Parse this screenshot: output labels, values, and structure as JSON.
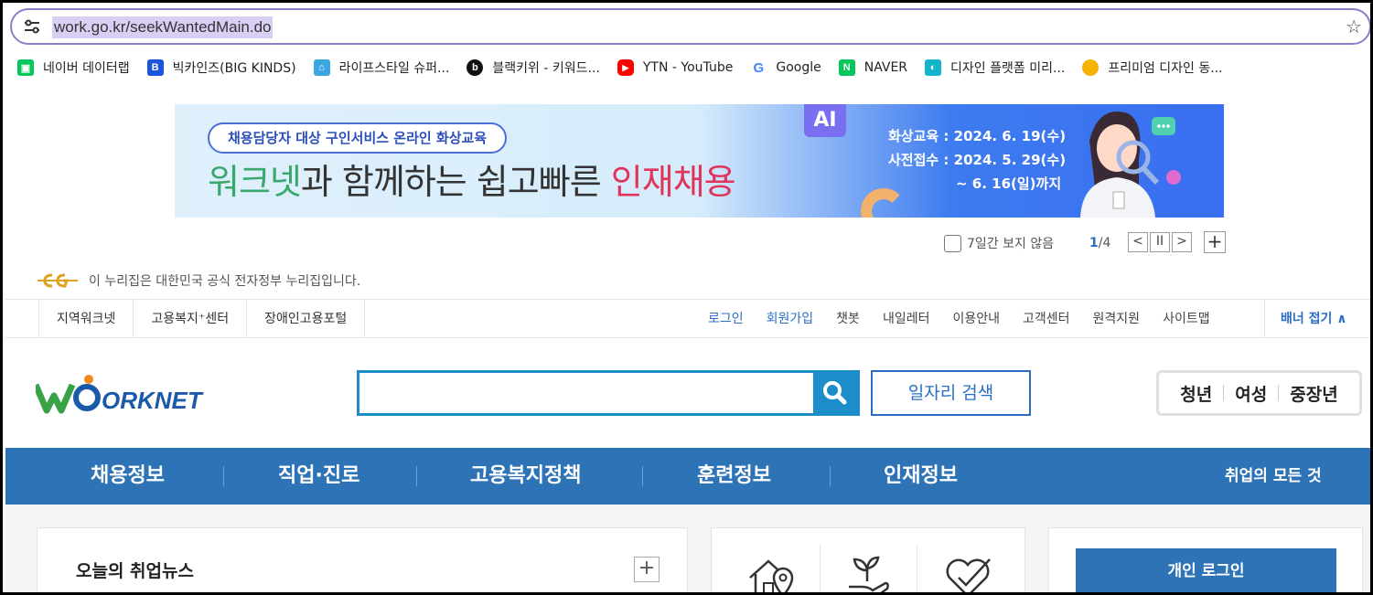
{
  "browser": {
    "url": "work.go.kr/seekWantedMain.do",
    "bookmarks": [
      {
        "label": "네이버 데이터랩",
        "icon": "naver-datalab-icon",
        "color": "#03c75a",
        "glyph": "▣"
      },
      {
        "label": "빅카인즈(BIG KINDS)",
        "icon": "bigkinds-icon",
        "color": "#1a56db",
        "glyph": "B"
      },
      {
        "label": "라이프스타일 슈퍼...",
        "icon": "lifestyle-icon",
        "color": "#3aa7e0",
        "glyph": "⌂"
      },
      {
        "label": "블랙키위 - 키워드...",
        "icon": "blackkiwi-icon",
        "color": "#111111",
        "glyph": "b"
      },
      {
        "label": "YTN - YouTube",
        "icon": "youtube-icon",
        "color": "#ff0000",
        "glyph": "▶"
      },
      {
        "label": "Google",
        "icon": "google-icon",
        "color": "#ffffff",
        "glyph": "G"
      },
      {
        "label": "NAVER",
        "icon": "naver-icon",
        "color": "#03c75a",
        "glyph": "N"
      },
      {
        "label": "디자인 플랫폼 미리...",
        "icon": "miricanvas-icon",
        "color": "#12b5c9",
        "glyph": "◐"
      },
      {
        "label": "프리미엄 디자인 동...",
        "icon": "mango-icon",
        "color": "#f5b301",
        "glyph": "●"
      }
    ]
  },
  "banner": {
    "pill": "채용담당자 대상 구인서비스 온라인 화상교육",
    "headline_green": "워크넷",
    "headline_mid": "과 함께하는 쉽고빠른 ",
    "headline_red": "인재채용",
    "ai_badge": "AI",
    "info_line1": "화상교육 : 2024. 6. 19(수)",
    "info_line2": "사전접수 : 2024. 5. 29(수)",
    "info_line3": "~ 6. 16(일)까지",
    "hide_week": "7일간 보지 않음",
    "page_current": "1",
    "page_total": "/4",
    "prev": "<",
    "pause": "II",
    "next": ">",
    "plus": "+"
  },
  "gov_notice": "이 누리집은 대한민국 공식 전자정부 누리집입니다.",
  "util": {
    "left": [
      "지역워크넷",
      "고용복지⁺센터",
      "장애인고용포털"
    ],
    "right": [
      {
        "label": "로그인",
        "blue": true
      },
      {
        "label": "회원가입",
        "blue": true
      },
      {
        "label": "챗봇",
        "blue": false
      },
      {
        "label": "내일레터",
        "blue": false
      },
      {
        "label": "이용안내",
        "blue": false
      },
      {
        "label": "고객센터",
        "blue": false
      },
      {
        "label": "원격지원",
        "blue": false
      },
      {
        "label": "사이트맵",
        "blue": false
      }
    ],
    "fold": "배너 접기 ∧"
  },
  "header": {
    "logo_text": "WORKNET",
    "search_value": "",
    "job_search": "일자리 검색",
    "groups": [
      "청년",
      "여성",
      "중장년"
    ]
  },
  "gnb": {
    "items": [
      "채용정보",
      "직업·진로",
      "고용복지정책",
      "훈련정보",
      "인재정보"
    ],
    "all": "취업의 모든 것"
  },
  "content": {
    "news_title": "오늘의 취업뉴스",
    "news_plus": "+",
    "login_button": "개인 로그인"
  },
  "colors": {
    "primary_blue": "#2d73b6",
    "search_blue": "#1d8dc9",
    "link_blue": "#2a6ec4",
    "banner_green": "#3aa76d",
    "banner_red": "#e0345a"
  }
}
